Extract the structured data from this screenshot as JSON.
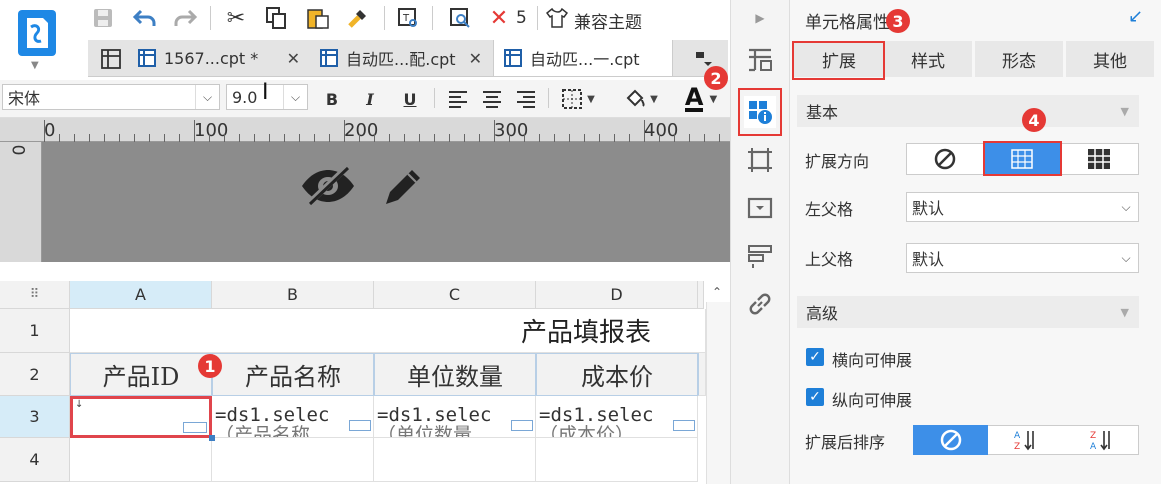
{
  "toolbar": {
    "undo_count": "5",
    "compat_theme": "兼容主题"
  },
  "tabs": [
    {
      "label": "1567...cpt *"
    },
    {
      "label": "自动匹...配.cpt"
    },
    {
      "label": "自动匹...一.cpt"
    }
  ],
  "format_bar": {
    "font_family": "宋体",
    "font_size": "9.0",
    "bold": "B",
    "italic": "I",
    "underline": "U"
  },
  "ruler": {
    "labels": [
      "0",
      "100",
      "200",
      "300",
      "400"
    ],
    "vertical_label": "0"
  },
  "grid": {
    "columns": [
      "A",
      "B",
      "C",
      "D"
    ],
    "rows": [
      "1",
      "2",
      "3",
      "4"
    ],
    "title": "产品填报表",
    "headers": [
      "产品ID",
      "产品名称",
      "单位数量",
      "成本价"
    ],
    "formulas": [
      "=ds1.selec",
      "=ds1.selec",
      "=ds1.selec"
    ],
    "formula_second_line": [
      "（产品名称",
      "（单位数量",
      "（成本价）"
    ]
  },
  "panel": {
    "title": "单元格属性",
    "tabs": [
      "扩展",
      "样式",
      "形态",
      "其他"
    ],
    "section_basic": "基本",
    "expand_direction_label": "扩展方向",
    "left_parent_label": "左父格",
    "left_parent_value": "默认",
    "upper_parent_label": "上父格",
    "upper_parent_value": "默认",
    "section_advanced": "高级",
    "horizontal_expand": "横向可伸展",
    "vertical_expand": "纵向可伸展",
    "sort_after_expand": "扩展后排序"
  },
  "badges": [
    "1",
    "2",
    "3",
    "4"
  ],
  "colors": {
    "accent": "#3d8fe8",
    "badge": "#e53935",
    "selected_col": "#d6ecf8"
  }
}
